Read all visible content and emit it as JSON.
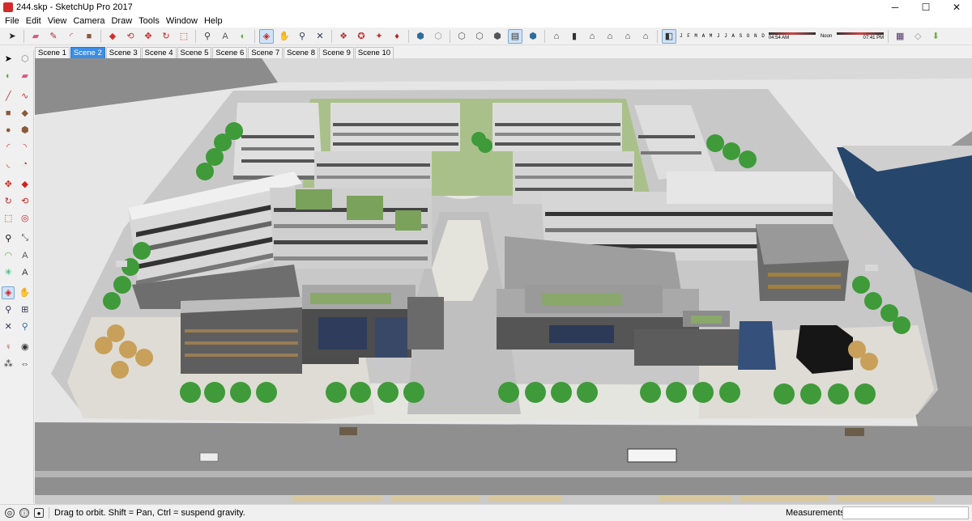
{
  "window": {
    "title": "244.skp - SketchUp Pro 2017",
    "minimize": "─",
    "maximize": "☐",
    "close": "✕"
  },
  "menu": [
    "File",
    "Edit",
    "View",
    "Camera",
    "Draw",
    "Tools",
    "Window",
    "Help"
  ],
  "toolbar": {
    "shadow_months": "J F M A M J J A S O N D",
    "time_start": "04:54 AM",
    "time_noon": "Noon",
    "time_end": "07:41 PM",
    "icons": [
      "select-icon",
      "eraser-icon",
      "pencil-icon",
      "eraser-line-icon",
      "paint-bucket-icon",
      "push-pull-icon",
      "move-icon",
      "rotate-icon",
      "scale-icon",
      "offset-icon",
      "tape-measure-icon",
      "dimension-icon",
      "protractor-icon",
      "text-icon",
      "orbit-icon",
      "pan-icon",
      "zoom-icon",
      "zoom-extents-icon",
      "warehouse-icon",
      "extension-icon",
      "component-icon",
      "ruby-icon",
      "xray-icon",
      "back-edges-icon",
      "wireframe-icon",
      "hidden-line-icon",
      "shaded-icon",
      "shaded-textures-icon",
      "monochrome-icon",
      "iso-icon",
      "top-view-icon",
      "front-view-icon",
      "right-view-icon",
      "back-view-icon",
      "left-view-icon",
      "shadows-icon",
      "fog-icon",
      "sandbox-icon",
      "section-icon"
    ]
  },
  "scenes": [
    "Scene 1",
    "Scene 2",
    "Scene 3",
    "Scene 4",
    "Scene 5",
    "Scene 6",
    "Scene 7",
    "Scene 8",
    "Scene 9",
    "Scene 10"
  ],
  "active_scene": "Scene 2",
  "status": {
    "message": "Drag to orbit. Shift = Pan, Ctrl = suspend gravity.",
    "measurements_label": "Measurements",
    "measurements_value": ""
  },
  "colors": {
    "accent": "#3a8ee6",
    "road": "#8f8f8f",
    "plaza": "#dcdcd6",
    "tree": "#3f9a3a",
    "water": "#2b4f7a"
  }
}
